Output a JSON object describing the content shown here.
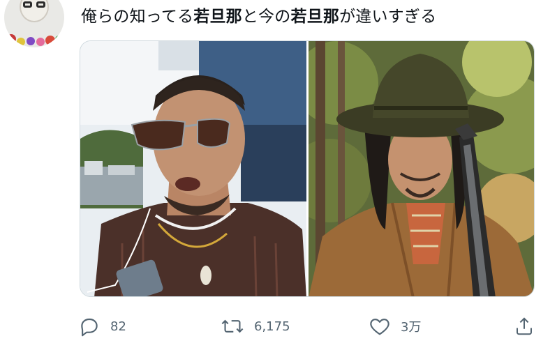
{
  "tweet": {
    "text_segments": [
      {
        "text": "俺らの知ってる",
        "bold": false
      },
      {
        "text": "若旦那",
        "bold": true
      },
      {
        "text": "と今の",
        "bold": false
      },
      {
        "text": "若旦那",
        "bold": true
      },
      {
        "text": "が違いすぎる",
        "bold": false
      }
    ]
  },
  "actions": {
    "reply_count": "82",
    "retweet_count": "6,175",
    "like_count": "3万"
  },
  "colors": {
    "action_gray": "#536471",
    "border": "#cfd9de"
  },
  "icons": {
    "reply": "speech-bubble-icon",
    "retweet": "retweet-arrows-icon",
    "like": "heart-outline-icon",
    "share": "share-upload-icon"
  }
}
